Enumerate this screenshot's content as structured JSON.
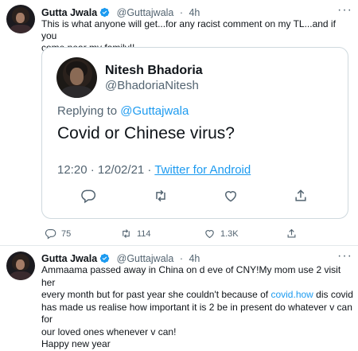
{
  "tweet1": {
    "author": "Gutta Jwala",
    "handle": "@Guttajwala",
    "separator": "·",
    "time": "4h",
    "text_line1": "This is what anyone will get...for any racist comment on my TL...and if you",
    "text_line2": "come near my family!!",
    "quoted": {
      "author": "Nitesh Bhadoria",
      "handle": "@BhadoriaNitesh",
      "replying_prefix": "Replying to ",
      "replying_handle": "@Guttajwala",
      "text": "Covid or Chinese virus?",
      "timestamp": "12:20 · 12/02/21 · ",
      "source": "Twitter for Android"
    },
    "actions": {
      "replies": "75",
      "retweets": "114",
      "likes": "1.3K"
    }
  },
  "tweet2": {
    "author": "Gutta Jwala",
    "handle": "@Guttajwala",
    "separator": "·",
    "time": "4h",
    "line1": "Ammaama passed away in China on d eve of CNY!My mom use 2 visit her",
    "line2_pre": "every month but for past year she couldn't because of ",
    "line2_link": "covid.how",
    "line2_post": " dis covid",
    "line3": "has made us realise how important it is 2 be in present do whatever v can for",
    "line4": "our loved ones whenever v can!",
    "line5": "Happy new year"
  },
  "colors": {
    "accent": "#1d9bf0",
    "verified": "#1d9bf0",
    "muted": "#536471",
    "border": "#cfd9de"
  }
}
